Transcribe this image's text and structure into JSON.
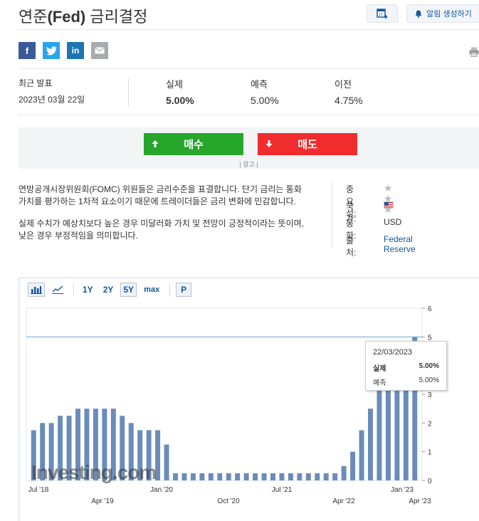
{
  "header": {
    "title_prefix": "연준",
    "title_bold": "(Fed)",
    "title_suffix": " 금리결정",
    "calendar_button_icon": "calendar-add-icon",
    "alert_button_label": "알림 생성하기"
  },
  "share": {
    "facebook": "f",
    "linkedin": "in"
  },
  "stats": {
    "release_label": "최근 발표",
    "release_date": "2023년 03월 22일",
    "actual_label": "실제",
    "actual_value": "5.00%",
    "forecast_label": "예측",
    "forecast_value": "5.00%",
    "previous_label": "이전",
    "previous_value": "4.75%"
  },
  "trade": {
    "buy_label": "매수",
    "sell_label": "매도",
    "ad_label": "| 광고 |",
    "buy_color": "#26a62b",
    "sell_color": "#f12c2c"
  },
  "description": {
    "paragraph_1": "연방공개시장위원회(FOMC) 위원들은 금리수준을 표결합니다. 단기 금리는 통화 가치를 평가하는 1차적 요소이기 때문에 트레이더들은 금리 변화에 민감합니다.",
    "paragraph_2": "실제 수치가 예상치보다 높은 경우 미달러화 가치 및 전망이 긍정적이라는 뜻이며, 낮은 경우 부정적임을 의미합니다."
  },
  "info": {
    "importance_label": "중요성:",
    "importance_stars": 3,
    "country_label": "국가:",
    "currency_label": "통화:",
    "currency_value": "USD",
    "source_label": "출처:",
    "source_value": "Federal Reserve"
  },
  "toolbar": {
    "bar_chart_icon": "bar-chart-icon",
    "line_chart_icon": "line-chart-icon",
    "range_1y": "1Y",
    "range_2y": "2Y",
    "range_5y": "5Y",
    "range_max": "max",
    "range_p": "P",
    "active_range": "5Y"
  },
  "tooltip": {
    "date": "22/03/2023",
    "actual_label": "실제",
    "actual_value": "5.00%",
    "forecast_label": "예측",
    "forecast_value": "5.00%"
  },
  "chart_data": {
    "type": "bar",
    "watermark": "Investing.com",
    "bar_color": "#6b8cba",
    "forecast_line_color": "#69a6c9",
    "ylim": [
      0,
      6
    ],
    "y_ticks": [
      "0",
      "1",
      "2",
      "3",
      "4",
      "5",
      "6"
    ],
    "forecast_line_value": 5.0,
    "x_ticks_upper": [
      "Jul '18",
      "Jan '20",
      "Jul '21",
      "Jan '23"
    ],
    "x_ticks_lower": [
      "Apr '19",
      "Oct '20",
      "Apr '22",
      "Apr '23"
    ],
    "values": [
      1.75,
      2.0,
      2.0,
      2.25,
      2.25,
      2.5,
      2.5,
      2.5,
      2.5,
      2.5,
      2.25,
      2.0,
      1.75,
      1.75,
      1.75,
      1.25,
      0.25,
      0.25,
      0.25,
      0.25,
      0.25,
      0.25,
      0.25,
      0.25,
      0.25,
      0.25,
      0.25,
      0.25,
      0.25,
      0.25,
      0.25,
      0.25,
      0.25,
      0.25,
      0.25,
      0.5,
      1.0,
      1.75,
      2.5,
      3.25,
      4.0,
      4.5,
      4.75,
      5.0
    ],
    "xlabel": "",
    "ylabel": ""
  }
}
